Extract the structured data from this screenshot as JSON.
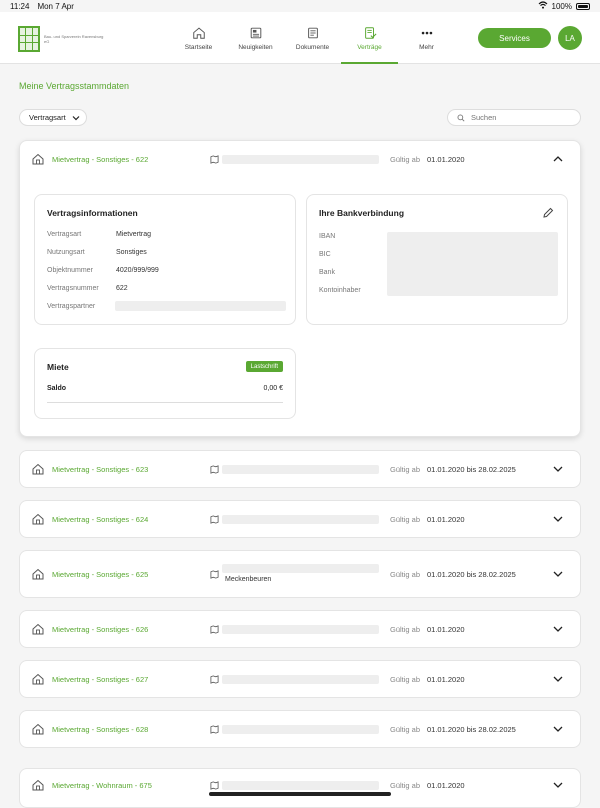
{
  "statusbar": {
    "time": "11:24",
    "date": "Mon 7 Apr",
    "battery": "100%"
  },
  "brand": {
    "logo_text": "Bau- und Sparverein Ravensburg eG",
    "accent": "#5aa832"
  },
  "nav": {
    "items": [
      {
        "label": "Startseite",
        "icon": "home-icon"
      },
      {
        "label": "Neuigkeiten",
        "icon": "news-icon"
      },
      {
        "label": "Dokumente",
        "icon": "document-icon"
      },
      {
        "label": "Verträge",
        "icon": "contract-icon"
      },
      {
        "label": "Mehr",
        "icon": "more-icon"
      }
    ],
    "active": "Verträge",
    "services_label": "Services",
    "avatar_initials": "LA"
  },
  "page": {
    "title": "Meine Vertragsstammdaten",
    "filter_label": "Vertragsart",
    "search_placeholder": "Suchen"
  },
  "expanded": {
    "title": "Mietvertrag - Sonstiges - 622",
    "valid_label": "Gültig ab",
    "valid_value": "01.01.2020",
    "info": {
      "heading": "Vertragsinformationen",
      "rows": [
        {
          "key": "Vertragsart",
          "value": "Mietvertrag"
        },
        {
          "key": "Nutzungsart",
          "value": "Sonstiges"
        },
        {
          "key": "Objektnummer",
          "value": "4020/999/999"
        },
        {
          "key": "Vertragsnummer",
          "value": "622"
        },
        {
          "key": "Vertragspartner",
          "value": ""
        }
      ]
    },
    "bank": {
      "heading": "Ihre Bankverbindung",
      "labels": [
        "IBAN",
        "BIC",
        "Bank",
        "Kontoinhaber"
      ]
    },
    "rent": {
      "heading": "Miete",
      "badge": "Lastschrift",
      "saldo_label": "Saldo",
      "saldo_value": "0,00 €"
    }
  },
  "contracts": [
    {
      "title": "Mietvertrag - Sonstiges - 623",
      "valid_label": "Gültig ab",
      "valid_value": "01.01.2020 bis 28.02.2025",
      "sub": ""
    },
    {
      "title": "Mietvertrag - Sonstiges - 624",
      "valid_label": "Gültig ab",
      "valid_value": "01.01.2020",
      "sub": ""
    },
    {
      "title": "Mietvertrag - Sonstiges - 625",
      "valid_label": "Gültig ab",
      "valid_value": "01.01.2020 bis 28.02.2025",
      "sub": "Meckenbeuren"
    },
    {
      "title": "Mietvertrag - Sonstiges - 626",
      "valid_label": "Gültig ab",
      "valid_value": "01.01.2020",
      "sub": ""
    },
    {
      "title": "Mietvertrag - Sonstiges - 627",
      "valid_label": "Gültig ab",
      "valid_value": "01.01.2020",
      "sub": ""
    },
    {
      "title": "Mietvertrag - Sonstiges - 628",
      "valid_label": "Gültig ab",
      "valid_value": "01.01.2020 bis 28.02.2025",
      "sub": ""
    },
    {
      "title": "Mietvertrag - Wohnraum - 675",
      "valid_label": "Gültig ab",
      "valid_value": "01.01.2020",
      "sub": ""
    }
  ]
}
